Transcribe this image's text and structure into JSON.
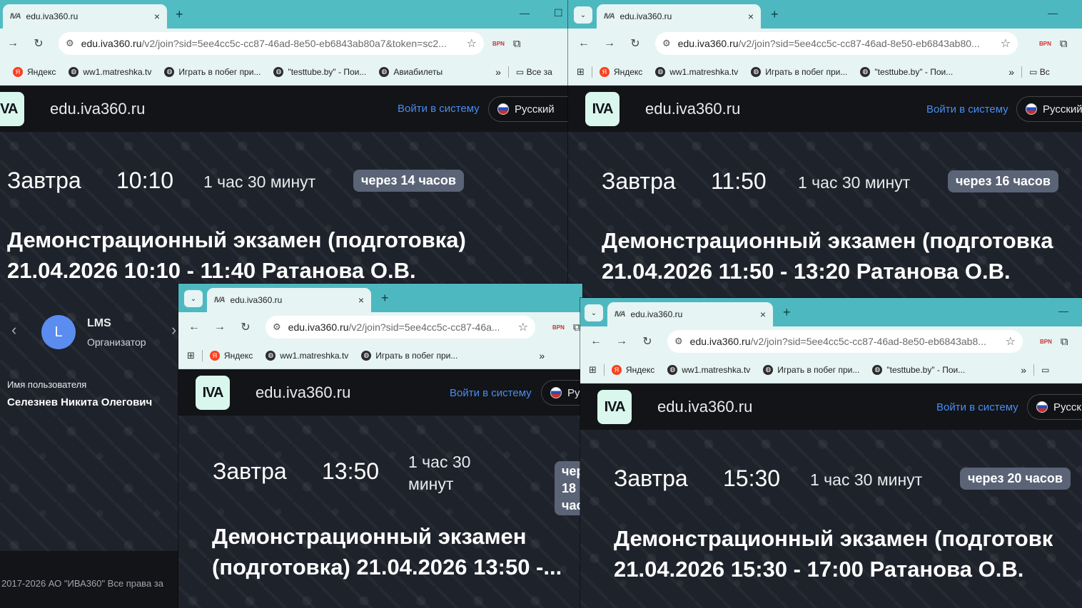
{
  "windows": [
    {
      "tab_title": "edu.iva360.ru",
      "url_host": "edu.iva360.ru",
      "url_path": "/v2/join?sid=5ee4cc5c-cc87-46ad-8e50-eb6843ab80a7&token=sc2...",
      "bookmarks": [
        "Яндекс",
        "ww1.matreshka.tv",
        "Играть в побег при...",
        "\"testtube.by\" - Пои...",
        "Авиабилеты"
      ],
      "bookmarks_folder": "Все за",
      "site_name": "edu.iva360.ru",
      "login": "Войти в систему",
      "language": "Русский",
      "day": "Завтра",
      "time": "10:10",
      "duration": "1 час 30 минут",
      "badge": "через 14 часов",
      "title_line1": "Демонстрационный экзамен (подготовка)",
      "title_line2": "21.04.2026 10:10 - 11:40 Ратанова О.В.",
      "organizer_initial": "L",
      "organizer_name": "LMS",
      "organizer_role": "Организатор",
      "user_label": "Имя пользователя",
      "user_value": "Селезнев Никита Олегович",
      "footer": "2017-2026 АО \"ИВА360\" Все права за"
    },
    {
      "tab_title": "edu.iva360.ru",
      "url_host": "edu.iva360.ru",
      "url_path": "/v2/join?sid=5ee4cc5c-cc87-46ad-8e50-eb6843ab80...",
      "bookmarks": [
        "Яндекс",
        "ww1.matreshka.tv",
        "Играть в побег при...",
        "\"testtube.by\" - Пои..."
      ],
      "bookmarks_folder": "Вс",
      "site_name": "edu.iva360.ru",
      "login": "Войти в систему",
      "language": "Русский",
      "day": "Завтра",
      "time": "11:50",
      "duration": "1 час 30 минут",
      "badge": "через 16 часов",
      "title_line1": "Демонстрационный экзамен (подготовка",
      "title_line2": "21.04.2026 11:50 - 13:20 Ратанова О.В."
    },
    {
      "tab_title": "edu.iva360.ru",
      "url_host": "edu.iva360.ru",
      "url_path": "/v2/join?sid=5ee4cc5c-cc87-46a...",
      "bookmarks": [
        "Яндекс",
        "ww1.matreshka.tv",
        "Играть в побег при..."
      ],
      "site_name": "edu.iva360.ru",
      "login": "Войти в систему",
      "language": "Ру",
      "day": "Завтра",
      "time": "13:50",
      "duration_line1": "1 час 30",
      "duration_line2": "минут",
      "badge_line1": "чер",
      "badge_line2": "18",
      "badge_line3": "час",
      "title_line1": "Демонстрационный экзамен",
      "title_line2": "(подготовка) 21.04.2026 13:50 -..."
    },
    {
      "tab_title": "edu.iva360.ru",
      "url_host": "edu.iva360.ru",
      "url_path": "/v2/join?sid=5ee4cc5c-cc87-46ad-8e50-eb6843ab8...",
      "bookmarks": [
        "Яндекс",
        "ww1.matreshka.tv",
        "Играть в побег при...",
        "\"testtube.by\" - Пои..."
      ],
      "site_name": "edu.iva360.ru",
      "login": "Войти в систему",
      "language": "Русск",
      "day": "Завтра",
      "time": "15:30",
      "duration": "1 час 30 минут",
      "badge": "через 20 часов",
      "title_line1": "Демонстрационный экзамен (подготовк",
      "title_line2": "21.04.2026 15:30 - 17:00 Ратанова О.В."
    }
  ],
  "icons": {
    "tab_close": "×",
    "new_tab": "+",
    "back": "←",
    "forward": "→",
    "reload": "↻",
    "star": "☆",
    "vpn": "BPN",
    "puzzle": "⧉",
    "apps": "⊞",
    "more": "»",
    "folder": "▭",
    "minimize": "—",
    "maximize": "☐",
    "chevron_left": "‹",
    "chevron_right": "›",
    "tab_search": "⌄",
    "logo_text": "IVA"
  },
  "colors": {
    "tabstrip": "#4eb8c0",
    "chrome": "#e6f4f4",
    "site_header": "#121417",
    "content_bg": "#1e222b",
    "link": "#4a8cf0",
    "badge": "#5b6476",
    "avatar": "#5a8def"
  }
}
